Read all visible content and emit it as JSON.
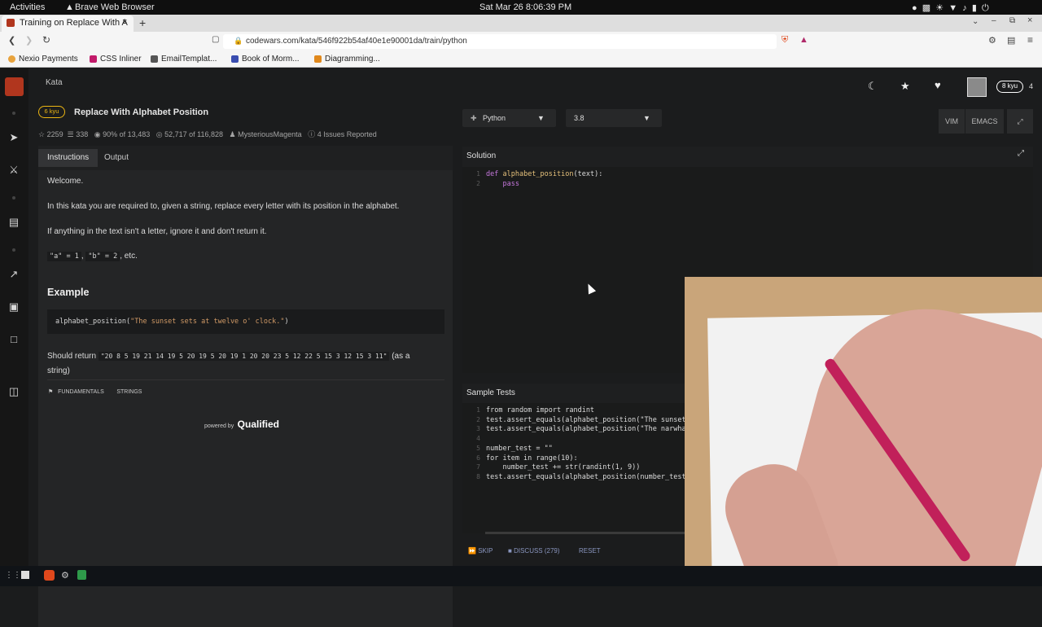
{
  "system_bar": {
    "activities": "Activities",
    "app_name": "Brave Web Browser",
    "datetime": "Sat Mar 26  8:06:39 PM"
  },
  "browser": {
    "tab_title": "Training on Replace With A",
    "url": "codewars.com/kata/546f922b54af40e1e90001da/train/python",
    "bookmarks": [
      "Nexio Payments",
      "CSS Inliner",
      "EmailTemplat...",
      "Book of Morm...",
      "Diagramming..."
    ]
  },
  "nav": {
    "kata_link": "Kata",
    "rank_badge": "8 kyu",
    "honor": "4"
  },
  "kata": {
    "rank": "6 kyu",
    "title": "Replace With Alphabet Position",
    "stars": "2259",
    "collections": "338",
    "satisfaction": "90% of 13,483",
    "completed": "52,717",
    "completed_of": "of 116,828",
    "author": "MysteriousMagenta",
    "issues": "4 Issues Reported"
  },
  "instructions": {
    "tab_instructions": "Instructions",
    "tab_output": "Output",
    "welcome": "Welcome.",
    "para1": "In this kata you are required to, given a string, replace every letter with its position in the alphabet.",
    "para2": "If anything in the text isn't a letter, ignore it and don't return it.",
    "code_a": "\"a\" = 1",
    "comma": ",",
    "code_b": "\"b\" = 2",
    "etc": ", etc.",
    "example_heading": "Example",
    "example_fn": "alphabet_position(",
    "example_arg": "\"The sunset sets at twelve o' clock.\"",
    "example_close": ")",
    "should_return": "Should return",
    "return_value": "\"20 8 5 19 21 14 19 5 20 19 5 20 19 1 20 20 23 5 12 22 5 15 3 12 15 3 11\"",
    "as_a": "(as a",
    "string": "string)",
    "tags": [
      "FUNDAMENTALS",
      "STRINGS"
    ],
    "powered_by": "powered by",
    "qualified": "Qualified"
  },
  "editor": {
    "language": "Python",
    "version": "3.8",
    "vim": "VIM",
    "emacs": "EMACS",
    "solution_title": "Solution",
    "solution_lines": [
      {
        "n": "1",
        "code": "def alphabet_position(text):"
      },
      {
        "n": "2",
        "code": "    pass"
      }
    ],
    "tests_title": "Sample Tests",
    "test_lines": [
      {
        "n": "1",
        "code": "from random import randint"
      },
      {
        "n": "2",
        "code": "test.assert_equals(alphabet_position(\"The sunset"
      },
      {
        "n": "3",
        "code": "test.assert_equals(alphabet_position(\"The narwha"
      },
      {
        "n": "4",
        "code": ""
      },
      {
        "n": "5",
        "code": "number_test = \"\""
      },
      {
        "n": "6",
        "code": "for item in range(10):"
      },
      {
        "n": "7",
        "code": "    number_test += str(randint(1, 9))"
      },
      {
        "n": "8",
        "code": "test.assert_equals(alphabet_position(number_test"
      }
    ],
    "skip": "SKIP",
    "discuss": "DISCUSS (279)",
    "reset": "RESET"
  },
  "colors": {
    "accent_red": "#b1361e",
    "rank_yellow": "#ecb613",
    "panel_dark": "#242526"
  }
}
